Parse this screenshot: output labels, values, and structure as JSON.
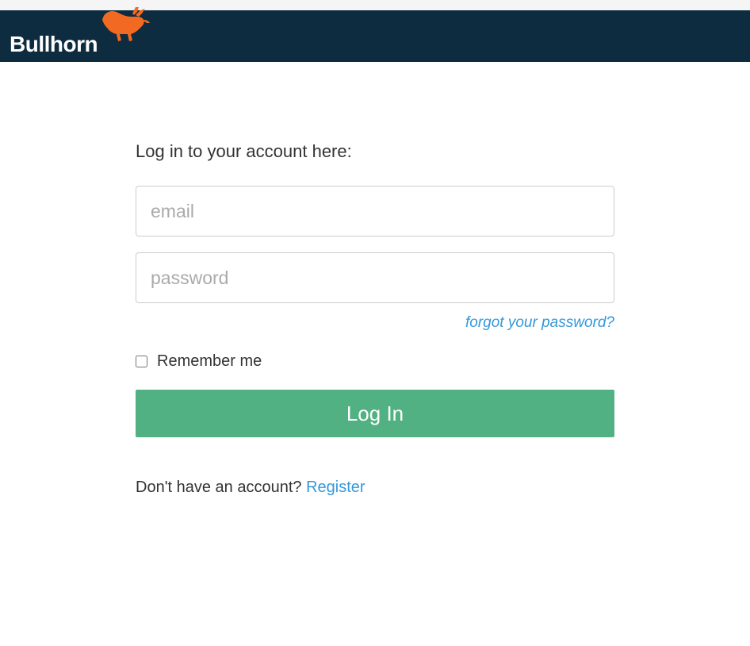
{
  "brand": {
    "name": "Bullhorn"
  },
  "form": {
    "heading": "Log in to your account here:",
    "email_placeholder": "email",
    "email_value": "",
    "password_placeholder": "password",
    "password_value": "",
    "forgot_link": "forgot your password?",
    "remember_label": "Remember me",
    "login_button": "Log In",
    "register_prompt": "Don't have an account? ",
    "register_link": "Register"
  },
  "colors": {
    "header_bg": "#0d2c40",
    "accent": "#52b183",
    "link": "#3498db",
    "bull": "#e67e22"
  }
}
